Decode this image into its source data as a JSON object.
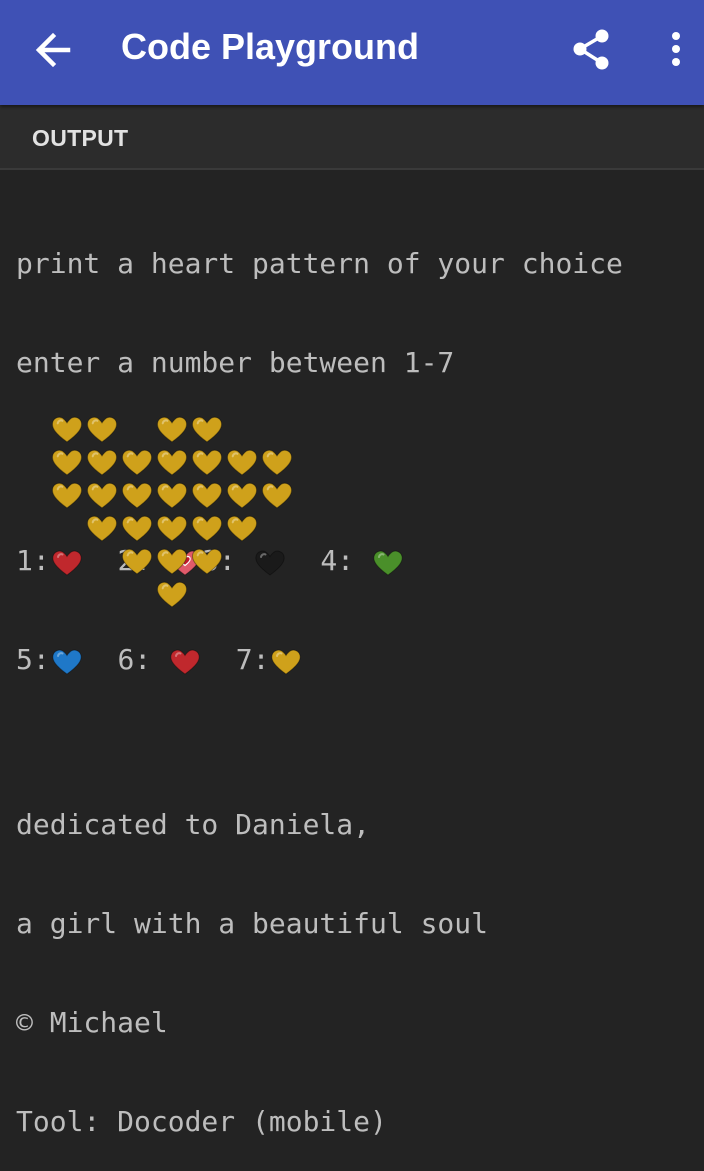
{
  "app": {
    "title": "Code Playground",
    "accent": "#3f51b5",
    "icons": {
      "back": "arrow-back-icon",
      "share": "share-icon",
      "more": "more-vert-icon"
    }
  },
  "tabs": {
    "output_label": "OUTPUT"
  },
  "console": {
    "line1": "print a heart pattern of your choice",
    "line2": "enter a number between 1-7",
    "options": [
      {
        "label": "1:",
        "heart": "red-heart-icon",
        "color": "#c0282d"
      },
      {
        "label": "2:",
        "heart": "sparkling-heart-icon",
        "color": "#e05a6a"
      },
      {
        "label": "3:",
        "heart": "black-heart-icon",
        "color": "#1a1a1a"
      },
      {
        "label": "4:",
        "heart": "green-heart-icon",
        "color": "#4a8f2a"
      },
      {
        "label": "5:",
        "heart": "blue-heart-icon",
        "color": "#1f78c8"
      },
      {
        "label": "6:",
        "heart": "red-heart-icon",
        "color": "#c0282d"
      },
      {
        "label": "7:",
        "heart": "yellow-heart-icon",
        "color": "#cfa11b"
      }
    ],
    "selected_heart_color": "#cfa11b",
    "heart_rows": [
      "xx xx",
      "xxxxxxx",
      "xxxxxxx",
      " xxxxx",
      "  xxx",
      "   x"
    ]
  },
  "footer": {
    "line1": "dedicated to Daniela,",
    "line2": "a girl with a beautiful soul",
    "line3": "© Michael",
    "line4": "Tool: Docoder (mobile)"
  }
}
